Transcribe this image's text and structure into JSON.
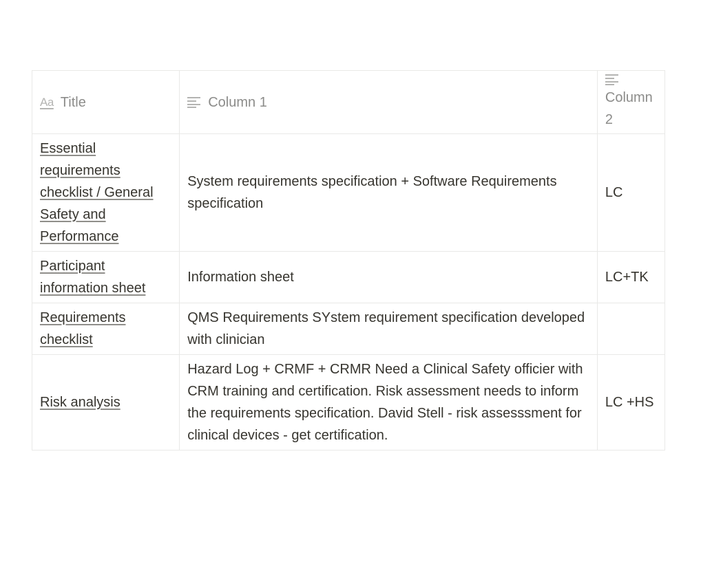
{
  "table": {
    "columns": [
      {
        "label": "Title",
        "icon": "text-aa-icon"
      },
      {
        "label": "Column 1",
        "icon": "text-lines-icon"
      },
      {
        "label": "Column 2",
        "icon": "text-lines-icon"
      }
    ],
    "rows": [
      {
        "title": "Essential requirements checklist / General Safety and Performance",
        "column1": "System requirements specification + Software Requirements specification",
        "column2": "LC"
      },
      {
        "title": "Participant information sheet",
        "column1": "Information sheet",
        "column2": "LC+TK"
      },
      {
        "title": "Requirements checklist",
        "column1": "QMS Requirements SYstem requirement specification developed with clinician",
        "column2": ""
      },
      {
        "title": "Risk analysis",
        "column1": "Hazard Log + CRMF + CRMR Need a Clinical Safety officier with CRM training and certification. Risk assessment needs to inform the requirements specification. David Stell - risk assesssment for clinical devices - get certification.",
        "column2": "LC +HS"
      }
    ]
  },
  "colors": {
    "text": "#37352f",
    "header_text": "#8c8c8a",
    "border": "#e9e9e7",
    "icon": "#b4b4b2"
  }
}
